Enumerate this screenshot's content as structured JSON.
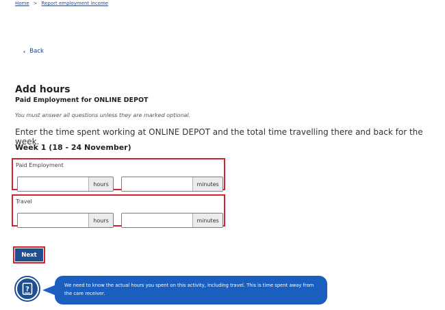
{
  "breadcrumb": {
    "items": [
      "Home",
      "Report employment income"
    ],
    "separator": ">"
  },
  "back": {
    "label": "Back",
    "icon": "chevron-left-icon"
  },
  "page": {
    "title": "Add hours",
    "subtitle": "Paid Employment for ONLINE DEPOT",
    "optional_note": "You must answer all questions unless they are marked optional.",
    "instruction": "Enter the time spent working at ONLINE DEPOT and the total time travelling there and back for the week.",
    "week_heading": "Week 1 (18 - 24 November)"
  },
  "groups": [
    {
      "label": "Paid Employment",
      "hours_value": "",
      "hours_unit": "hours",
      "minutes_value": "",
      "minutes_unit": "minutes"
    },
    {
      "label": "Travel",
      "hours_value": "",
      "hours_unit": "hours",
      "minutes_value": "",
      "minutes_unit": "minutes"
    }
  ],
  "next_button": {
    "label": "Next"
  },
  "helper": {
    "icon": "help-book-icon",
    "text": "We need to know the actual hours you spent on this activity, including travel. This is time spent away from the care receiver."
  },
  "colors": {
    "primary": "#1d4f91",
    "highlight": "#d4212c",
    "bubble": "#1a5fbf",
    "link": "#2f4a8c"
  }
}
